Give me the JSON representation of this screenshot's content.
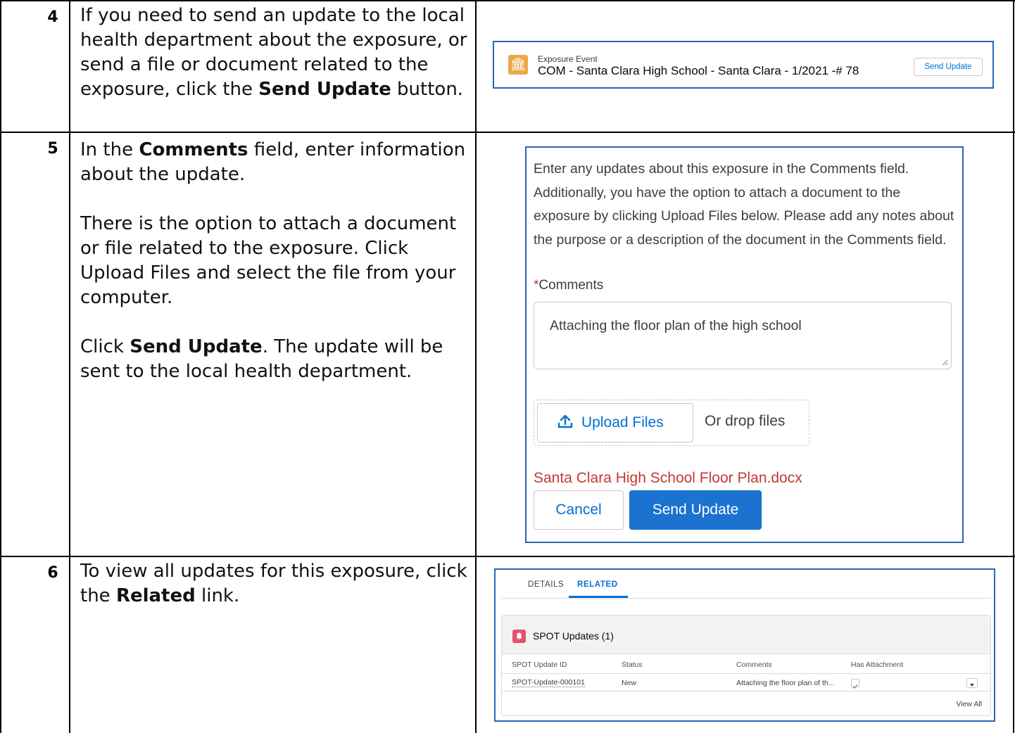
{
  "steps": [
    {
      "number": "4",
      "paragraphs": [
        [
          {
            "text": "If you need to send an update to the local health department about the exposure, or send a file or document related to the exposure, click the ",
            "bold": false
          },
          {
            "text": "Send Update",
            "bold": true
          },
          {
            "text": " button.",
            "bold": false
          }
        ]
      ]
    },
    {
      "number": "5",
      "paragraphs": [
        [
          {
            "text": "In the ",
            "bold": false
          },
          {
            "text": "Comments",
            "bold": true
          },
          {
            "text": " field, enter information about the update.",
            "bold": false
          }
        ],
        [
          {
            "text": "There is the option to attach a document or file related to the exposure. Click Upload Files and select the file from your computer.",
            "bold": false
          }
        ],
        [
          {
            "text": "Click ",
            "bold": false
          },
          {
            "text": "Send Update",
            "bold": true
          },
          {
            "text": ". The update will be sent to the local health department.",
            "bold": false
          }
        ]
      ]
    },
    {
      "number": "6",
      "paragraphs": [
        [
          {
            "text": "To view all updates for this exposure, click the ",
            "bold": false
          },
          {
            "text": "Related",
            "bold": true
          },
          {
            "text": " link.",
            "bold": false
          }
        ]
      ]
    }
  ],
  "screenshot_exposure": {
    "icon": "bank-icon",
    "label": "Exposure Event",
    "title": "COM - Santa Clara High School - Santa Clara - 1/2021 -# 78",
    "button": "Send Update"
  },
  "screenshot_form": {
    "description": "Enter any updates about this exposure in the Comments field. Additionally, you have the option to attach a document to the exposure by clicking Upload Files below. Please add any notes about the purpose or a description of the document in the Comments field.",
    "required_marker": "*",
    "comments_label": "Comments",
    "comments_value": "Attaching the floor plan of the high school",
    "upload_button": "Upload Files",
    "drop_text": "Or drop files",
    "attached_file": "Santa Clara High School Floor Plan.docx",
    "cancel_button": "Cancel",
    "send_button": "Send Update"
  },
  "screenshot_related": {
    "tabs": [
      {
        "label": "DETAILS",
        "active": false
      },
      {
        "label": "RELATED",
        "active": true
      }
    ],
    "card_title": "SPOT Updates (1)",
    "columns": [
      "SPOT Update ID",
      "Status",
      "Comments",
      "Has Attachment"
    ],
    "rows": [
      {
        "id": "SPOT-Update-000101",
        "status": "New",
        "comments": "Attaching the floor plan of th...",
        "has_attachment": true
      }
    ],
    "view_all": "View All"
  },
  "colors": {
    "link_blue": "#0070d2",
    "brand_button": "#1b72d0",
    "frame_border": "#2b66b1",
    "error_red": "#c23934",
    "exposure_icon": "#e9a94a",
    "updates_icon": "#e3506a"
  }
}
